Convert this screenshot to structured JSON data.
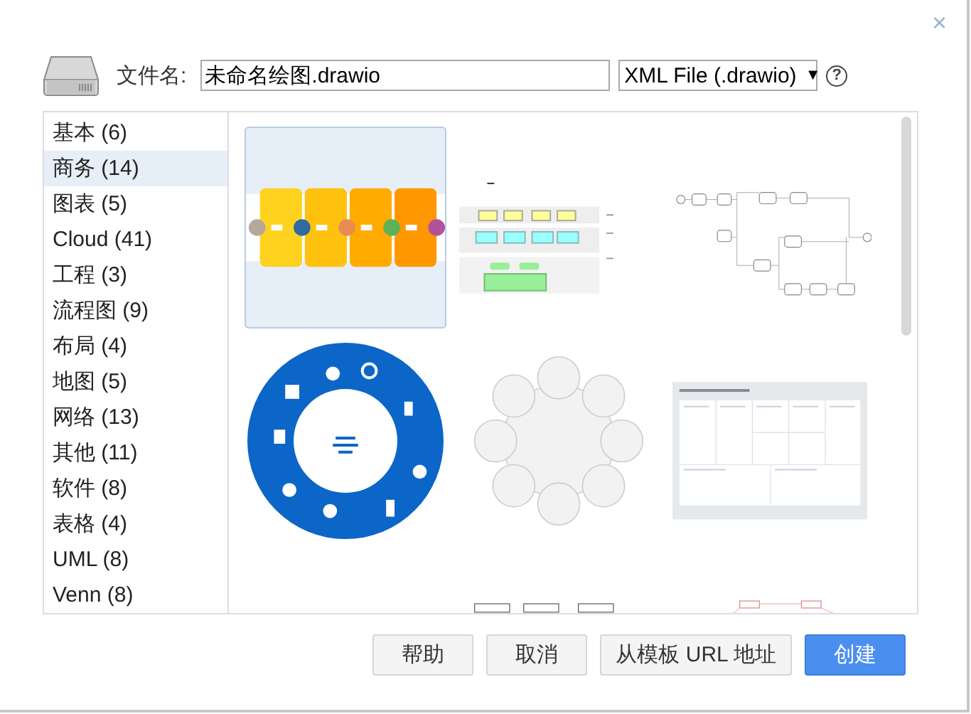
{
  "dialog": {
    "close": "×"
  },
  "file": {
    "label": "文件名:",
    "value": "未命名绘图.drawio",
    "format": "XML File (.drawio)",
    "format_caret": "▼",
    "help": "?"
  },
  "categories": [
    {
      "label": "基本 (6)",
      "selected": false
    },
    {
      "label": "商务 (14)",
      "selected": true
    },
    {
      "label": "图表 (5)",
      "selected": false
    },
    {
      "label": "Cloud (41)",
      "selected": false
    },
    {
      "label": "工程 (3)",
      "selected": false
    },
    {
      "label": "流程图 (9)",
      "selected": false
    },
    {
      "label": "布局 (4)",
      "selected": false
    },
    {
      "label": "地图 (5)",
      "selected": false
    },
    {
      "label": "网络 (13)",
      "selected": false
    },
    {
      "label": "其他 (11)",
      "selected": false
    },
    {
      "label": "软件 (8)",
      "selected": false
    },
    {
      "label": "表格 (4)",
      "selected": false
    },
    {
      "label": "UML (8)",
      "selected": false
    },
    {
      "label": "Venn (8)",
      "selected": false
    }
  ],
  "templates": [
    {
      "kind": "pipeline",
      "selected": true
    },
    {
      "kind": "layers",
      "selected": false
    },
    {
      "kind": "process",
      "selected": false
    },
    {
      "kind": "ring",
      "selected": false
    },
    {
      "kind": "cycle",
      "selected": false
    },
    {
      "kind": "canvas",
      "selected": false
    },
    {
      "kind": "blank",
      "selected": false
    },
    {
      "kind": "cells",
      "selected": false
    },
    {
      "kind": "links",
      "selected": false
    }
  ],
  "buttons": [
    {
      "label": "帮助",
      "kind": "plain"
    },
    {
      "label": "取消",
      "kind": "plain"
    },
    {
      "label": "从模板 URL 地址",
      "kind": "plain"
    },
    {
      "label": "创建",
      "kind": "primary"
    }
  ]
}
